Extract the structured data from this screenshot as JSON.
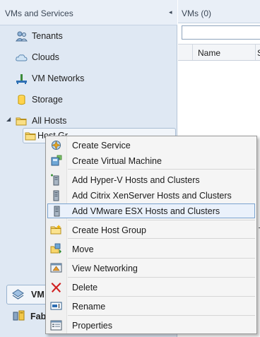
{
  "left_pane": {
    "title": "VMs and Services",
    "collapse_glyph": "◂",
    "tree": {
      "tenants": "Tenants",
      "clouds": "Clouds",
      "vm_networks": "VM Networks",
      "storage": "Storage",
      "all_hosts": "All Hosts",
      "all_hosts_expander": "◢",
      "host_child": "Host Gr…"
    },
    "wunderbar": {
      "vms_label": "VM",
      "fabric_label": "Fab"
    }
  },
  "right_pane": {
    "title": "VMs (0)",
    "search_value": "",
    "columns": [
      "Name",
      "S"
    ]
  },
  "context_menu": {
    "items": [
      {
        "id": "create-service",
        "label": "Create Service",
        "icon": "service-template-icon"
      },
      {
        "id": "create-vm",
        "label": "Create Virtual Machine",
        "icon": "virtual-machine-icon"
      },
      {
        "id": "add-hyperv",
        "label": "Add Hyper-V Hosts and Clusters",
        "icon": "hyperv-host-icon"
      },
      {
        "id": "add-citrix",
        "label": "Add Citrix XenServer Hosts and Clusters",
        "icon": "xenserver-host-icon"
      },
      {
        "id": "add-vmware",
        "label": "Add VMware ESX Hosts and Clusters",
        "icon": "esx-host-icon",
        "highlighted": true
      },
      {
        "id": "create-host-group",
        "label": "Create Host Group",
        "icon": "host-group-icon"
      },
      {
        "id": "move",
        "label": "Move",
        "icon": "move-icon"
      },
      {
        "id": "view-networking",
        "label": "View Networking",
        "icon": "networking-icon"
      },
      {
        "id": "delete",
        "label": "Delete",
        "icon": "delete-icon"
      },
      {
        "id": "rename",
        "label": "Rename",
        "icon": "rename-icon"
      },
      {
        "id": "properties",
        "label": "Properties",
        "icon": "properties-icon"
      }
    ]
  },
  "colors": {
    "nav_background": "#dfe8f3",
    "header_background": "#e9eff7",
    "menu_highlight": "#eaf1fb",
    "menu_highlight_border": "#7aa3cf",
    "delete_red": "#d02020",
    "folder_yellow": "#f0c840"
  }
}
